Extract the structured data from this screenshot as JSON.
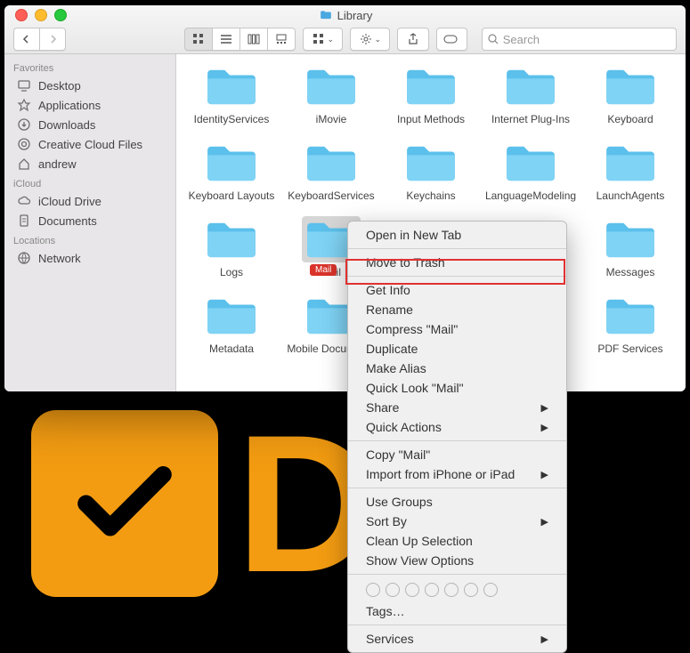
{
  "window_title": "Library",
  "search": {
    "placeholder": "Search"
  },
  "sidebar": {
    "groups": [
      {
        "label": "Favorites",
        "items": [
          {
            "icon": "desktop",
            "label": "Desktop"
          },
          {
            "icon": "app",
            "label": "Applications"
          },
          {
            "icon": "download",
            "label": "Downloads"
          },
          {
            "icon": "cc",
            "label": "Creative Cloud Files"
          },
          {
            "icon": "home",
            "label": "andrew"
          }
        ]
      },
      {
        "label": "iCloud",
        "items": [
          {
            "icon": "cloud",
            "label": "iCloud Drive"
          },
          {
            "icon": "doc",
            "label": "Documents"
          }
        ]
      },
      {
        "label": "Locations",
        "items": [
          {
            "icon": "globe",
            "label": "Network"
          }
        ]
      }
    ]
  },
  "folders": [
    "IdentityServices",
    "iMovie",
    "Input Methods",
    "Internet Plug-Ins",
    "Keyboard",
    "Keyboard Layouts",
    "KeyboardServices",
    "Keychains",
    "LanguageModeling",
    "LaunchAgents",
    "Logs",
    "Mail",
    "",
    "",
    "Messages",
    "Metadata",
    "Mobile Documents",
    "",
    "",
    "PDF Services"
  ],
  "selected_index": 11,
  "tag_label": "Mail",
  "context_menu": {
    "sections": [
      [
        "Open in New Tab"
      ],
      [
        "Move to Trash"
      ],
      [
        "Get Info",
        "Rename",
        "Compress \"Mail\"",
        "Duplicate",
        "Make Alias",
        "Quick Look \"Mail\"",
        {
          "t": "Share",
          "sub": true
        },
        {
          "t": "Quick Actions",
          "sub": true
        }
      ],
      [
        "Copy \"Mail\"",
        {
          "t": "Import from iPhone or iPad",
          "sub": true
        }
      ],
      [
        "Use Groups",
        {
          "t": "Sort By",
          "sub": true
        },
        "Clean Up Selection",
        "Show View Options"
      ],
      [
        "__tags__",
        "Tags…"
      ],
      [
        {
          "t": "Services",
          "sub": true
        }
      ]
    ],
    "highlighted": "Move to Trash"
  }
}
